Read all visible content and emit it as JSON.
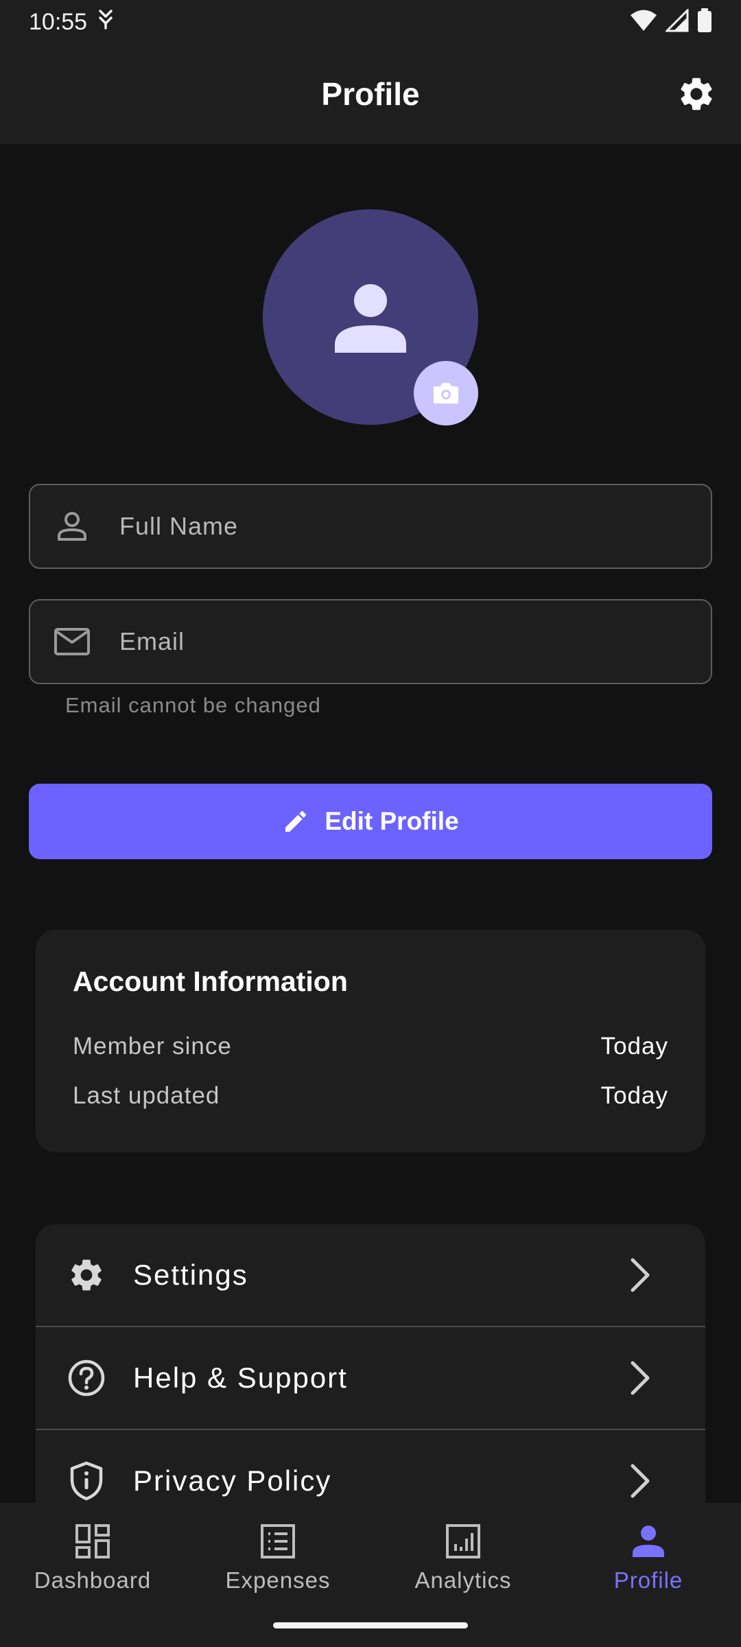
{
  "status_bar": {
    "time": "10:55"
  },
  "app_bar": {
    "title": "Profile"
  },
  "profile": {
    "full_name_placeholder": "Full Name",
    "email_placeholder": "Email",
    "email_helper": "Email cannot be changed",
    "edit_button_label": "Edit Profile"
  },
  "account_info": {
    "title": "Account Information",
    "rows": [
      {
        "label": "Member since",
        "value": "Today"
      },
      {
        "label": "Last updated",
        "value": "Today"
      }
    ]
  },
  "menu": {
    "items": [
      {
        "label": "Settings",
        "icon": "gear-icon"
      },
      {
        "label": "Help & Support",
        "icon": "help-circle-icon"
      },
      {
        "label": "Privacy Policy",
        "icon": "shield-icon"
      }
    ]
  },
  "bottom_nav": {
    "items": [
      {
        "label": "Dashboard",
        "icon": "dashboard-icon",
        "active": false
      },
      {
        "label": "Expenses",
        "icon": "receipt-list-icon",
        "active": false
      },
      {
        "label": "Analytics",
        "icon": "analytics-icon",
        "active": false
      },
      {
        "label": "Profile",
        "icon": "person-icon",
        "active": true
      }
    ]
  },
  "colors": {
    "background": "#121212",
    "surface": "#1e1e1e",
    "accent": "#6c63ff",
    "avatar_bg": "#433e78",
    "camera_bg": "#cbc5ff",
    "nav_active": "#7a72ff"
  }
}
